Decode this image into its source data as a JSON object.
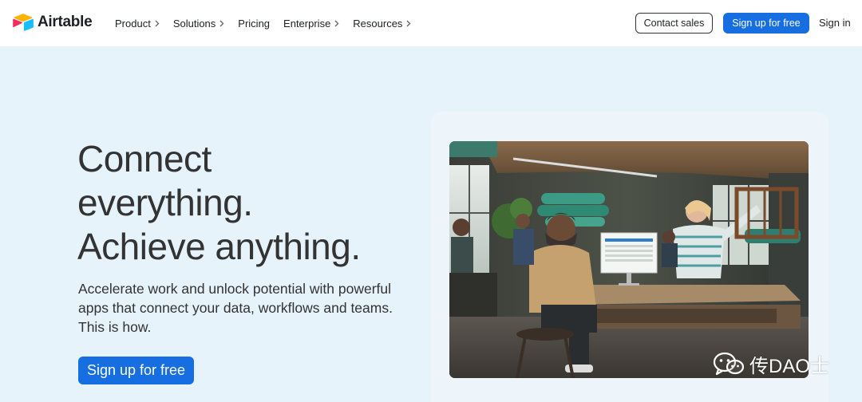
{
  "brand": {
    "name": "Airtable",
    "colors": {
      "yellow": "#fcb400",
      "red": "#f82b60",
      "blue": "#18bfff",
      "navy": "#1d1f25"
    }
  },
  "nav": {
    "items": [
      {
        "label": "Product",
        "has_chevron": true
      },
      {
        "label": "Solutions",
        "has_chevron": true
      },
      {
        "label": "Pricing",
        "has_chevron": false
      },
      {
        "label": "Enterprise",
        "has_chevron": true
      },
      {
        "label": "Resources",
        "has_chevron": true
      }
    ],
    "contact_sales": "Contact sales",
    "signup": "Sign up for free",
    "signin": "Sign in"
  },
  "hero": {
    "headline": [
      "Connect",
      "everything.",
      "Achieve anything."
    ],
    "subtext": "Accelerate work and unlock potential with powerful apps that connect your data, workflows and teams. This is how.",
    "cta": "Sign up for free",
    "image": "office-workspace-photo"
  },
  "watermark": {
    "icon": "wechat-icon",
    "text": "传DAO士"
  },
  "colors": {
    "background": "#e7f3fb",
    "primary_button": "#166ee1",
    "text": "#333333"
  }
}
